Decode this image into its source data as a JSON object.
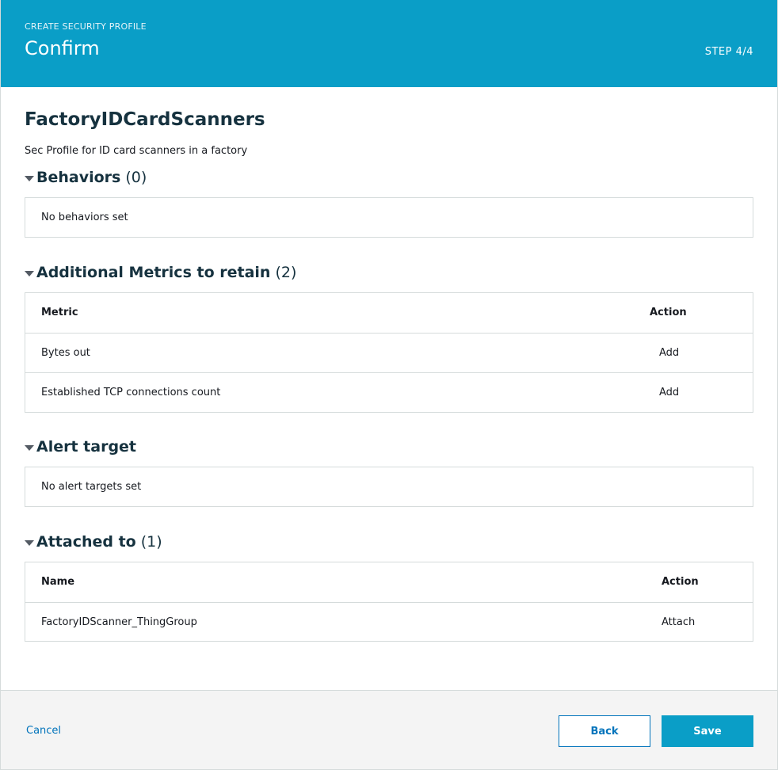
{
  "header": {
    "breadcrumb": "CREATE SECURITY PROFILE",
    "title": "Confirm",
    "step": "STEP 4/4"
  },
  "profile": {
    "name": "FactoryIDCardScanners",
    "description": "Sec Profile for ID card scanners in a factory"
  },
  "behaviors": {
    "label": "Behaviors",
    "count": "(0)",
    "empty_text": "No behaviors set"
  },
  "metrics": {
    "label": "Additional Metrics to retain",
    "count": "(2)",
    "columns": [
      "Metric",
      "Action"
    ],
    "rows": [
      {
        "metric": "Bytes out",
        "action": "Add"
      },
      {
        "metric": "Established TCP connections count",
        "action": "Add"
      }
    ]
  },
  "alert": {
    "label": "Alert target",
    "empty_text": "No alert targets set"
  },
  "attached": {
    "label": "Attached to",
    "count": "(1)",
    "columns": [
      "Name",
      "Action"
    ],
    "rows": [
      {
        "name": "FactoryIDScanner_ThingGroup",
        "action": "Attach"
      }
    ]
  },
  "footer": {
    "cancel_label": "Cancel",
    "back_label": "Back",
    "save_label": "Save"
  },
  "colors": {
    "header_bg": "#0a9ec7",
    "link": "#0073bb",
    "primary_button": "#0a9ec7",
    "heading_text": "#16323f"
  },
  "icons": {
    "section_toggle": "caret-down-icon"
  }
}
